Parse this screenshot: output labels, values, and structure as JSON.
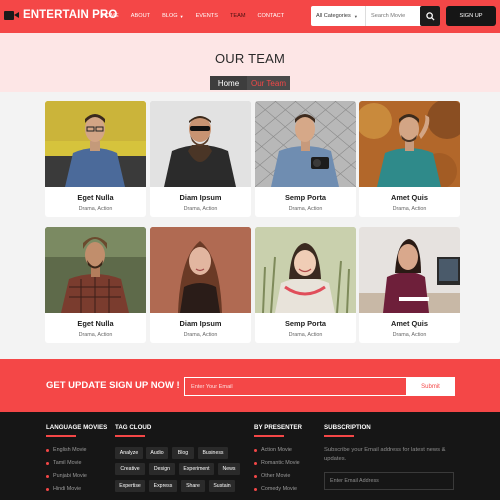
{
  "nav": {
    "brand": "ENTERTAIN PRO",
    "items": [
      "HOME",
      "ABOUT",
      "BLOG",
      "EVENTS",
      "TEAM",
      "CONTACT"
    ],
    "active": "TEAM",
    "category_select": "All Categories",
    "search_placeholder": "Search Movie",
    "signup_label": "SIGN UP"
  },
  "hero": {
    "title": "OUR TEAM",
    "breadcrumb_home": "Home",
    "breadcrumb_current": "Our Team"
  },
  "team": [
    {
      "name": "Eget Nulla",
      "role": "Drama, Action"
    },
    {
      "name": "Diam Ipsum",
      "role": "Drama, Action"
    },
    {
      "name": "Semp Porta",
      "role": "Drama, Action"
    },
    {
      "name": "Amet Quis",
      "role": "Drama, Action"
    },
    {
      "name": "Eget Nulla",
      "role": "Drama, Action"
    },
    {
      "name": "Diam Ipsum",
      "role": "Drama, Action"
    },
    {
      "name": "Semp Porta",
      "role": "Drama, Action"
    },
    {
      "name": "Amet Quis",
      "role": "Drama, Action"
    }
  ],
  "newsletter": {
    "title": "GET UPDATE SIGN UP NOW !",
    "placeholder": "Enter Your Email",
    "button": "Submit"
  },
  "footer": {
    "language_title": "LANGUAGE MOVIES",
    "languages": [
      "English Movie",
      "Tamil Movie",
      "Punjabi Movie",
      "Hindi Movie"
    ],
    "tags_title": "TAG CLOUD",
    "tags": [
      "Analyze",
      "Audio",
      "Blog",
      "Business",
      "Creative",
      "Design",
      "Experiment",
      "News",
      "Expertise",
      "Express",
      "Share",
      "Sustain"
    ],
    "presenter_title": "BY PRESENTER",
    "presenters": [
      "Action Movie",
      "Romantic Movie",
      "Other Movie",
      "Comedy Movie"
    ],
    "subscription_title": "SUBSCRIPTION",
    "subscription_text": "Subscribe your Email address for latest news & updates.",
    "subscription_placeholder": "Enter Email Address"
  },
  "colors": {
    "accent": "#f44747",
    "dark": "#161616",
    "hero_bg": "#fde6e6"
  }
}
